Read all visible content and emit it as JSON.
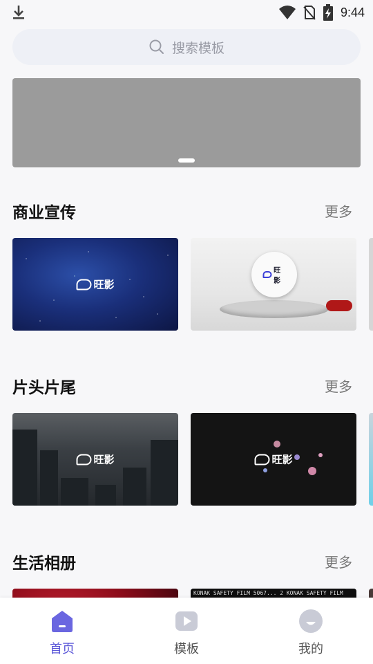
{
  "status_bar": {
    "time": "9:44",
    "icons": [
      "download-icon",
      "wifi-icon",
      "no-sim-icon",
      "battery-charging-icon"
    ]
  },
  "search": {
    "placeholder": "搜索模板",
    "icon": "search-icon"
  },
  "banner": {
    "pages": 1,
    "current_page": 1
  },
  "sections": [
    {
      "title": "商业宣传",
      "more": "更多",
      "cards": [
        {
          "logo": "旺影"
        },
        {
          "logo": "旺影"
        }
      ]
    },
    {
      "title": "片头片尾",
      "more": "更多",
      "cards": [
        {
          "logo": "旺影"
        },
        {
          "logo": "旺影"
        }
      ]
    },
    {
      "title": "生活相册",
      "more": "更多",
      "cards": [
        {
          "caption": "KONAK SAFETY FILM 5067... 2 KONAK SAFETY FILM"
        }
      ]
    }
  ],
  "bottom_nav": {
    "items": [
      {
        "label": "首页",
        "icon": "home-icon",
        "active": true
      },
      {
        "label": "模板",
        "icon": "play-icon",
        "active": false
      },
      {
        "label": "我的",
        "icon": "profile-icon",
        "active": false
      }
    ]
  },
  "colors": {
    "accent": "#5b57d8",
    "background": "#f7f7f9",
    "search_bg": "#eef0f6"
  }
}
